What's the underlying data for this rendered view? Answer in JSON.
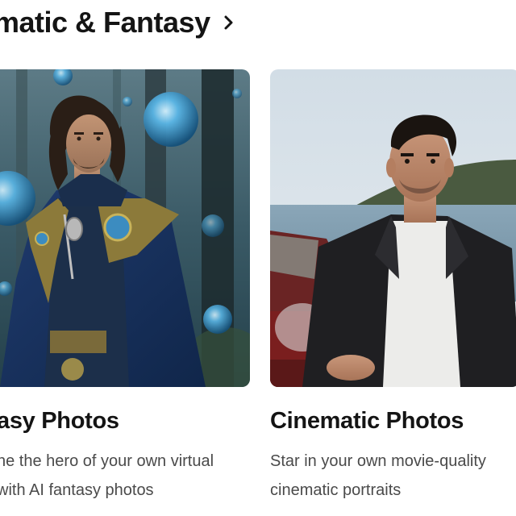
{
  "section": {
    "title": "matic & Fantasy",
    "chevron_icon": "chevron-right-icon"
  },
  "cards": [
    {
      "title": "asy Photos",
      "description_lines": [
        "ne the hero of your own virtual",
        "with AI fantasy photos"
      ],
      "image": "fantasy-wizard-portrait"
    },
    {
      "title": "Cinematic Photos",
      "description_lines": [
        "Star in your own movie-quality",
        "cinematic portraits"
      ],
      "image": "cinematic-man-portrait"
    }
  ],
  "colors": {
    "title": "#141414",
    "description": "#4a4a4a",
    "background": "#ffffff"
  }
}
